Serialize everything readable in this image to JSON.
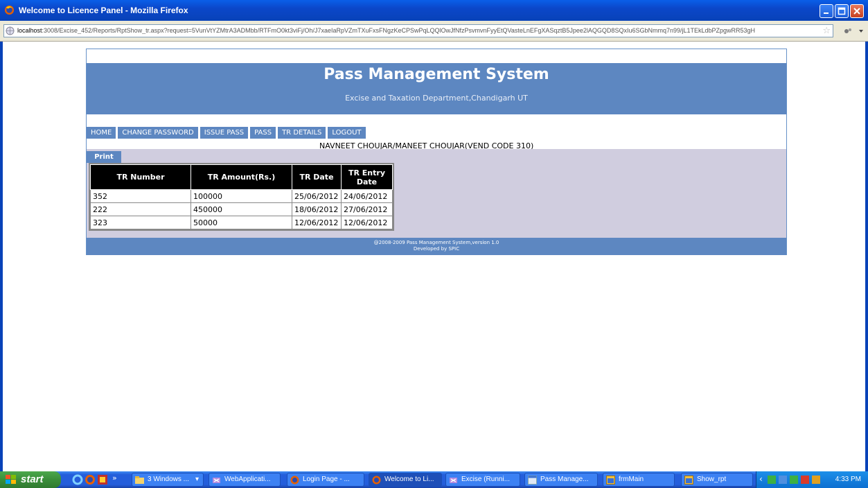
{
  "window": {
    "title": "Welcome to Licence Panel - Mozilla Firefox"
  },
  "browser": {
    "url_host": "localhost",
    "url_rest": ":3008/Excise_452/Reports/RptShow_tr.aspx?request=5VunVtYZMtrA3ADMbb/RTFmO0kt3viFj/Oh/J7xaeIaRpVZmTXuFxsFNgzKeCPSwPqLQQlOwJfNfzPsvmvnFyyEtQVasteLnEFgXASqztB5Jpee2lAQGQD8SQxIu6SGbNmmq7n99/jL1TEkLdbPZpgwRR53gH"
  },
  "page": {
    "system_title": "Pass Management System",
    "department": "Excise and Taxation Department,Chandigarh UT",
    "menu": [
      "HOME",
      "CHANGE PASSWORD",
      "ISSUE PASS",
      "PASS",
      "TR DETAILS",
      "LOGOUT"
    ],
    "vendor": "NAVNEET CHOUJAR/MANEET CHOUJAR(VEND CODE 310)",
    "print_label": "Print",
    "table": {
      "headers": [
        "TR Number",
        "TR Amount(Rs.)",
        "TR Date",
        "TR Entry Date"
      ],
      "rows": [
        [
          "352",
          "100000",
          "25/06/2012",
          "24/06/2012"
        ],
        [
          "222",
          "450000",
          "18/06/2012",
          "27/06/2012"
        ],
        [
          "323",
          "50000",
          "12/06/2012",
          "12/06/2012"
        ]
      ]
    },
    "footer_line1": "@2008-2009 Pass Management System,version 1.0",
    "footer_line2": "Developed by SPIC"
  },
  "taskbar": {
    "start_label": "start",
    "buttons": [
      "3 Windows ...",
      "WebApplicati...",
      "Login Page - ...",
      "Welcome to Li...",
      "Excise (Runni...",
      "Pass Manage...",
      "frmMain",
      "Show_rpt"
    ],
    "clock": "4:33 PM"
  }
}
